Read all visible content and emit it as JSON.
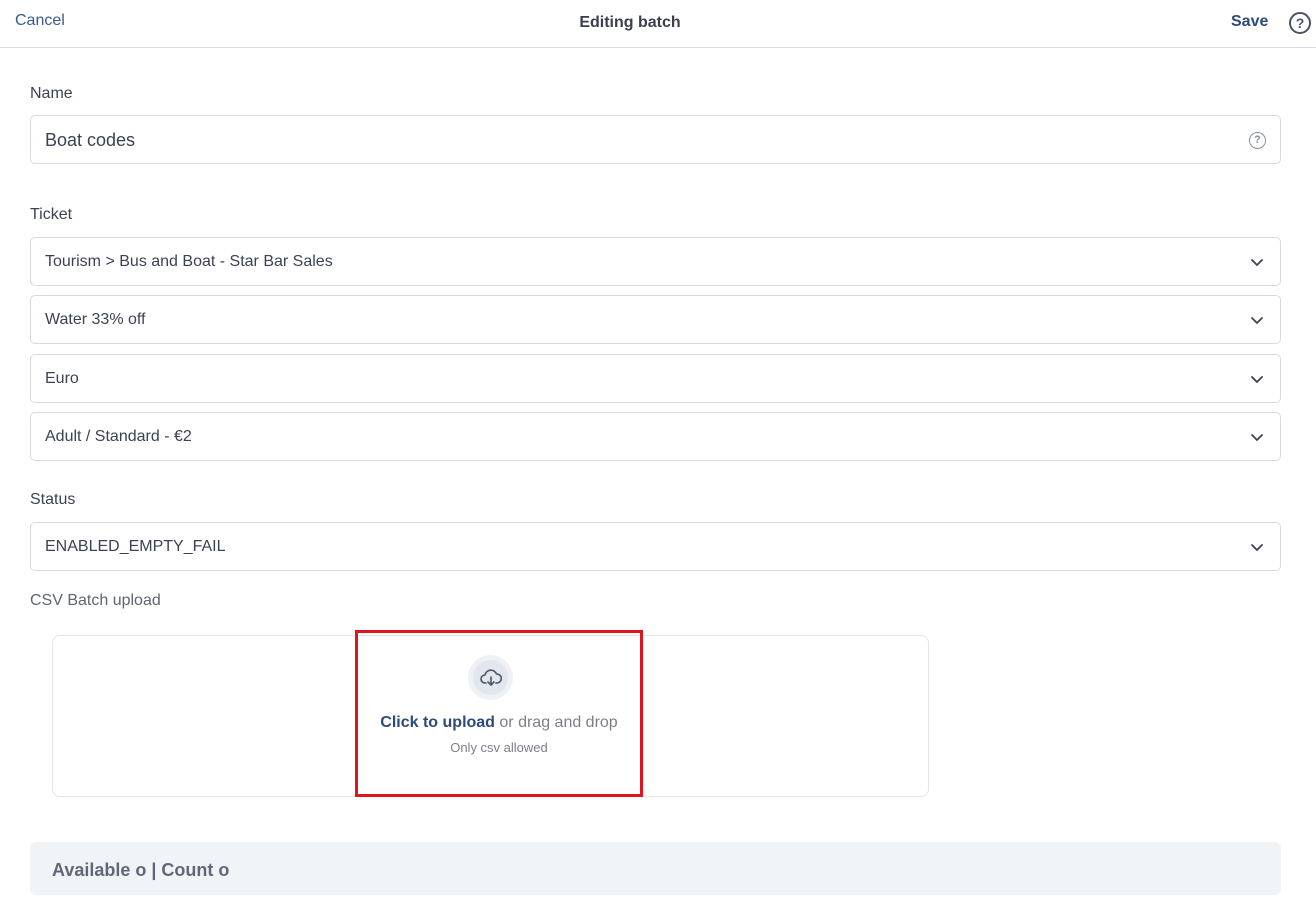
{
  "header": {
    "cancel_label": "Cancel",
    "title": "Editing batch",
    "save_label": "Save",
    "help_glyph": "?"
  },
  "form": {
    "name": {
      "label": "Name",
      "value": "Boat codes",
      "help_glyph": "?"
    },
    "ticket": {
      "label": "Ticket",
      "selects": [
        {
          "value": "Tourism > Bus and Boat - Star Bar Sales"
        },
        {
          "value": "Water 33% off"
        },
        {
          "value": "Euro"
        },
        {
          "value": "Adult / Standard - €2"
        }
      ]
    },
    "status": {
      "label": "Status",
      "value": "ENABLED_EMPTY_FAIL"
    },
    "csv": {
      "label": "CSV Batch upload",
      "click_label": "Click to upload",
      "drag_label": " or drag and drop",
      "hint": "Only csv allowed",
      "icon": "cloud-download-icon"
    }
  },
  "footer": {
    "summary": "Available o | Count o"
  },
  "colors": {
    "accent": "#2c4a7a",
    "highlight": "#e0141b",
    "footer_bg": "#f1f4f7"
  }
}
